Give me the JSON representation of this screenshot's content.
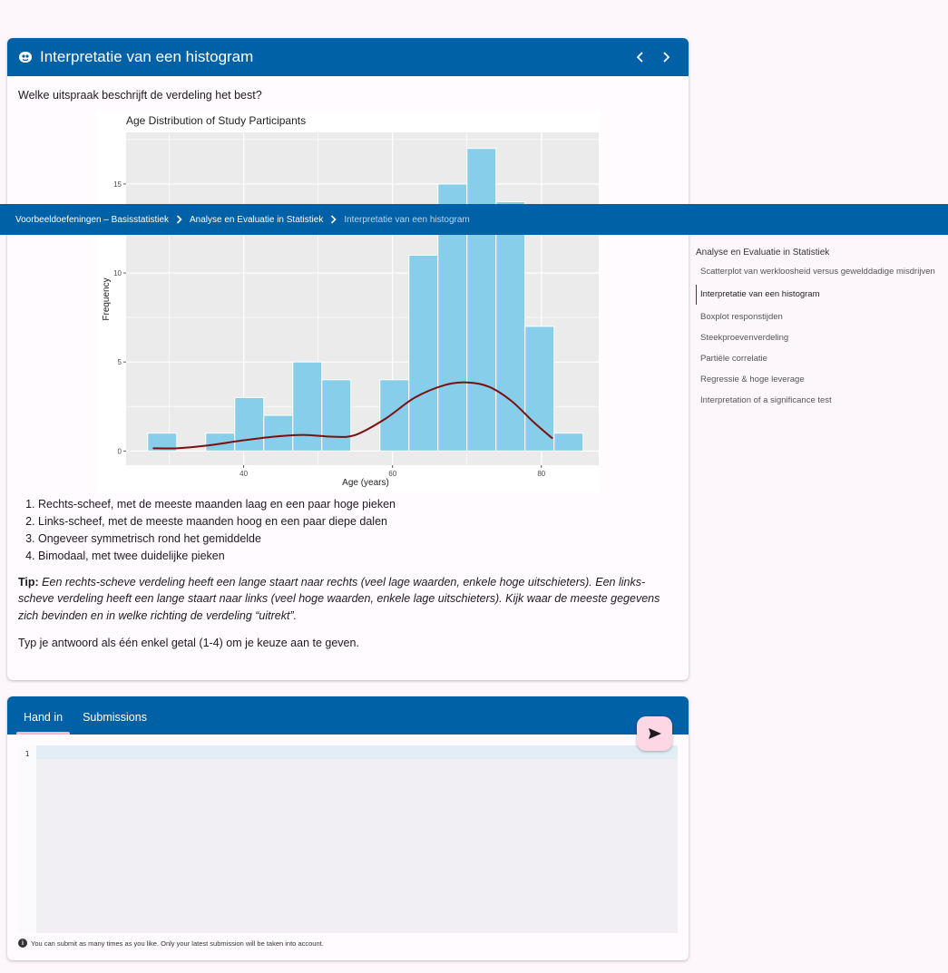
{
  "exercise": {
    "title": "Interpretatie van een histogram",
    "question": "Welke uitspraak beschrijft de verdeling het best?",
    "options": [
      "Rechts-scheef, met de meeste maanden laag en een paar hoge pieken",
      "Links-scheef, met de meeste maanden hoog en een paar diepe dalen",
      "Ongeveer symmetrisch rond het gemiddelde",
      "Bimodaal, met twee duidelijke pieken"
    ],
    "tip_label": "Tip:",
    "tip_text": "Een rechts-scheve verdeling heeft een lange staart naar rechts (veel lage waarden, enkele hoge uitschieters). Een links-scheve verdeling heeft een lange staart naar links (veel hoge waarden, enkele lage uitschieters). Kijk waar de meeste gegevens zich bevinden en in welke richting de verdeling “uitrekt”.",
    "instruction": "Typ je antwoord als één enkel getal (1-4) om je keuze aan te geven."
  },
  "chart_data": {
    "type": "bar",
    "title": "Age Distribution of Study Participants",
    "xlabel": "Age (years)",
    "ylabel": "Frequency",
    "bin_width": 3.9,
    "x_start": 27.1,
    "bin_values": [
      1,
      0,
      1,
      3,
      2,
      5,
      4,
      0,
      4,
      11,
      15,
      17,
      14,
      7,
      1
    ],
    "x_ticks": [
      40,
      60,
      80
    ],
    "y_ticks": [
      0,
      5,
      10,
      15
    ],
    "xlim": [
      24.2,
      87.7
    ],
    "ylim": [
      -0.8,
      17.9
    ],
    "density_curve": {
      "x": [
        27.8,
        31,
        35,
        40,
        44,
        48,
        52,
        55,
        59,
        63,
        67,
        70,
        73,
        76,
        79,
        81.5
      ],
      "y": [
        0.15,
        0.15,
        0.3,
        0.6,
        0.8,
        0.9,
        0.8,
        0.9,
        1.8,
        3.0,
        3.7,
        3.85,
        3.6,
        2.8,
        1.6,
        0.7
      ]
    },
    "colors": {
      "bar": "#87ceeb",
      "curve": "#7b1010",
      "panel": "#ebebeb",
      "grid": "#ffffff"
    },
    "grid": true
  },
  "breadcrumb": {
    "items": [
      "Voorbeeldoefeningen – Basisstatistiek",
      "Analyse en Evaluatie in Statistiek"
    ],
    "current": "Interpretatie van een histogram"
  },
  "sidebar": {
    "heading": "Analyse en Evaluatie in Statistiek",
    "items": [
      "Scatterplot van werkloosheid versus gewelddadige misdrijven",
      "Interpretatie van een histogram",
      "Boxplot responstijden",
      "Steekproevenverdeling",
      "Partiële correlatie",
      "Regressie & hoge leverage",
      "Interpretation of a significance test"
    ],
    "active_index": 1
  },
  "submission": {
    "tabs": [
      "Hand in",
      "Submissions"
    ],
    "line_number": "1",
    "note": "You can submit as many times as you like. Only your latest submission will be taken into account."
  },
  "icons": {
    "header": "dodona-logo-icon",
    "prev": "chevron-left-icon",
    "next": "chevron-right-icon",
    "send": "send-icon",
    "info": "info-icon"
  }
}
